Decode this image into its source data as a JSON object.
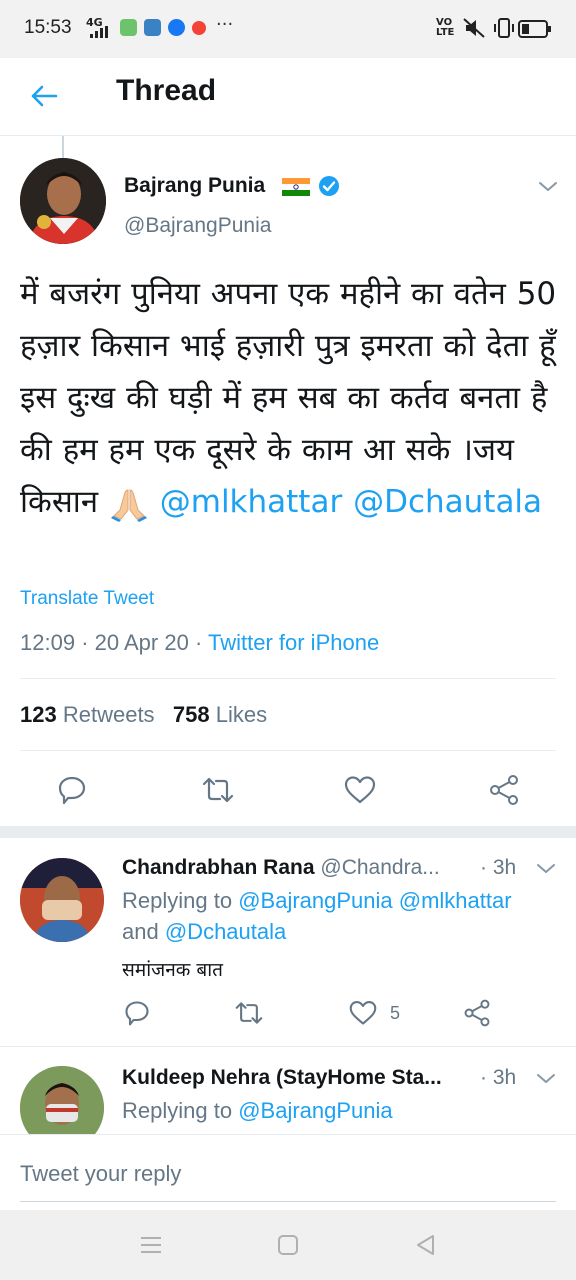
{
  "status_bar": {
    "time": "15:53",
    "network": "4G",
    "volte": "VO LTE",
    "more": "···",
    "colors": {
      "app1": "#6cc36c",
      "app2": "#3b82c4",
      "app3": "#1877f2",
      "app4": "#f44336"
    }
  },
  "header": {
    "title": "Thread",
    "back_icon": "arrow-left-icon"
  },
  "tweet": {
    "author_name": "Bajrang Punia",
    "author_flag": "india-flag-icon",
    "author_handle": "@BajrangPunia",
    "text": "में बजरंग पुनिया अपना एक महीने का वतेन 50 हज़ार किसान भाई हज़ारी पुत्र इमरता को देता हूँ इस दुःख की घड़ी में हम सब का कर्तव बनता है की हम हम एक दूसरे के काम आ सके  ।जय किसान",
    "mention_1": "@mlkhattar",
    "mention_2": "@Dchautala",
    "translate": "Translate Tweet",
    "time": "12:09",
    "separator": "·",
    "date": "20 Apr 20",
    "source": "Twitter for iPhone",
    "retweets_count": "123",
    "retweets_label": "Retweets",
    "likes_count": "758",
    "likes_label": "Likes"
  },
  "replies": [
    {
      "name": "Chandrabhan Rana",
      "handle": "@Chandra...",
      "time": "· 3h",
      "replying_prefix": "Replying to",
      "replying_to": "@BajrangPunia @mlkhattar",
      "replying_and": "and",
      "replying_to_2": "@Dchautala",
      "text": "समांजनक बात",
      "likes": "5"
    },
    {
      "name": "Kuldeep Nehra (StayHome Sta...",
      "time": "· 3h",
      "replying_prefix": "Replying to",
      "replying_to": "@BajrangPunia"
    }
  ],
  "compose": {
    "placeholder": "Tweet your reply"
  },
  "colors": {
    "accent": "#1da1f2",
    "secondary_text": "#657786",
    "divider": "#e6ecf0"
  }
}
